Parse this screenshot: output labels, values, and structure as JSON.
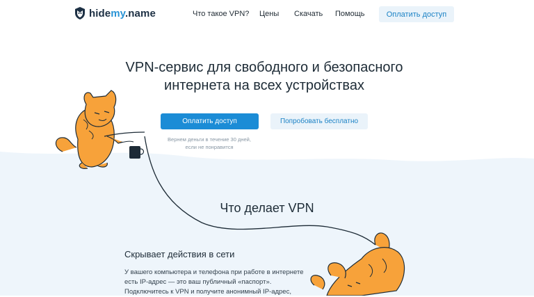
{
  "header": {
    "logo": {
      "prefix": "hide",
      "accent": "my",
      "suffix": ".name"
    },
    "nav": [
      {
        "label": "Что такое VPN?"
      },
      {
        "label": "Цены"
      },
      {
        "label": "Скачать"
      },
      {
        "label": "Помощь"
      }
    ],
    "cta_label": "Оплатить доступ"
  },
  "hero": {
    "title_line1": "VPN-сервис для свободного и безопасного",
    "title_line2": "интернета на всех устройствах",
    "primary_button": "Оплатить доступ",
    "secondary_button": "Попробовать бесплатно",
    "refund_line1": "Вернем деньги в течение 30 дней,",
    "refund_line2": "если не понравится"
  },
  "what_vpn_does": {
    "title": "Что делает VPN",
    "feature": {
      "title": "Скрывает действия в сети",
      "lines": [
        "У вашего компьютера и телефона при работе в интернете",
        "есть IP-адрес — это ваш публичный «паспорт».",
        "Подключитесь к VPN и получите анонимный IP-адрес,"
      ]
    }
  },
  "colors": {
    "accent": "#1b8cd6",
    "light_button": "#eaf3fa",
    "wave_background": "#eef5fb",
    "cat_orange": "#f7a23a"
  }
}
